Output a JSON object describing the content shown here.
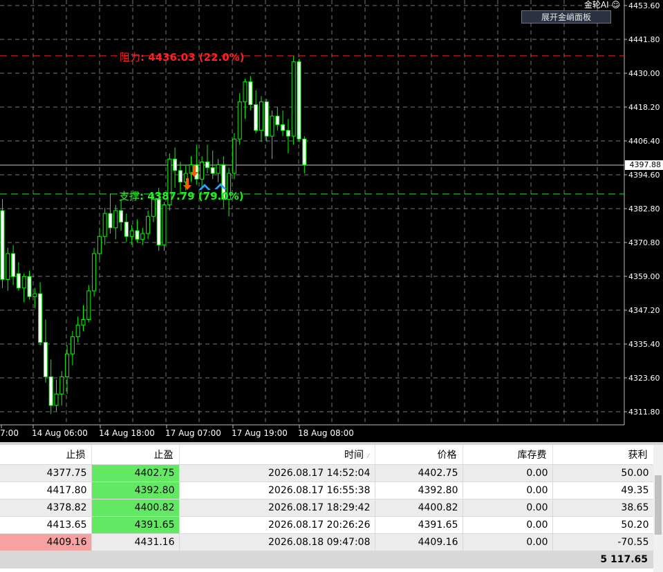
{
  "chart": {
    "brand": "金轮AI ☺",
    "panel_button": "展开金峭面板",
    "resistance": {
      "name": "阻力",
      "value": ": 4436.03 (22.0%)"
    },
    "support": {
      "name": "支撑",
      "value": ": 4387.79 (79.0%)"
    },
    "current_price": "4397.88",
    "resistance_price": 4436.03,
    "support_price": 4387.79,
    "price_axis_labels": [
      "4453.60",
      "4441.80",
      "4430.00",
      "4418.20",
      "4406.40",
      "4394.60",
      "4382.80",
      "4370.80",
      "4359.00",
      "4347.20",
      "4335.40",
      "4323.60",
      "4311.80"
    ],
    "time_axis_labels": [
      "7:00",
      "14 Aug 06:00",
      "14 Aug 18:00",
      "17 Aug 07:00",
      "17 Aug 19:00",
      "18 Aug 08:00"
    ],
    "colors": {
      "grid": "#7a7a7a",
      "candle_up_fill": "#000000",
      "candle_bar": "#00ff00",
      "candle_down_fill": "#ffffff",
      "resistance": "#ff2020",
      "support": "#22ee22",
      "arrow_down": "#ff5a00",
      "arrow_up": "#2aa0ff"
    }
  },
  "table": {
    "headers": {
      "sl": "止损",
      "tp": "止盈",
      "time": "时间",
      "price": "价格",
      "swap": "库存费",
      "profit": "获利"
    },
    "rows": [
      {
        "sl": "4377.75",
        "tp": "4402.75",
        "time": "2026.08.17 14:52:04",
        "price": "4402.75",
        "swap": "0.00",
        "profit": "50.00"
      },
      {
        "sl": "4417.80",
        "tp": "4392.80",
        "time": "2026.08.17 16:55:38",
        "price": "4392.80",
        "swap": "0.00",
        "profit": "49.35"
      },
      {
        "sl": "4378.82",
        "tp": "4400.82",
        "time": "2026.08.17 18:29:42",
        "price": "4400.82",
        "swap": "0.00",
        "profit": "38.65"
      },
      {
        "sl": "4413.65",
        "tp": "4391.65",
        "time": "2026.08.17 20:26:26",
        "price": "4391.65",
        "swap": "0.00",
        "profit": "50.20"
      },
      {
        "sl": "4409.16",
        "tp": "4431.16",
        "time": "2026.08.18 09:47:08",
        "price": "4409.16",
        "swap": "0.00",
        "profit": "-70.55"
      }
    ],
    "total": "5 117.65"
  }
}
